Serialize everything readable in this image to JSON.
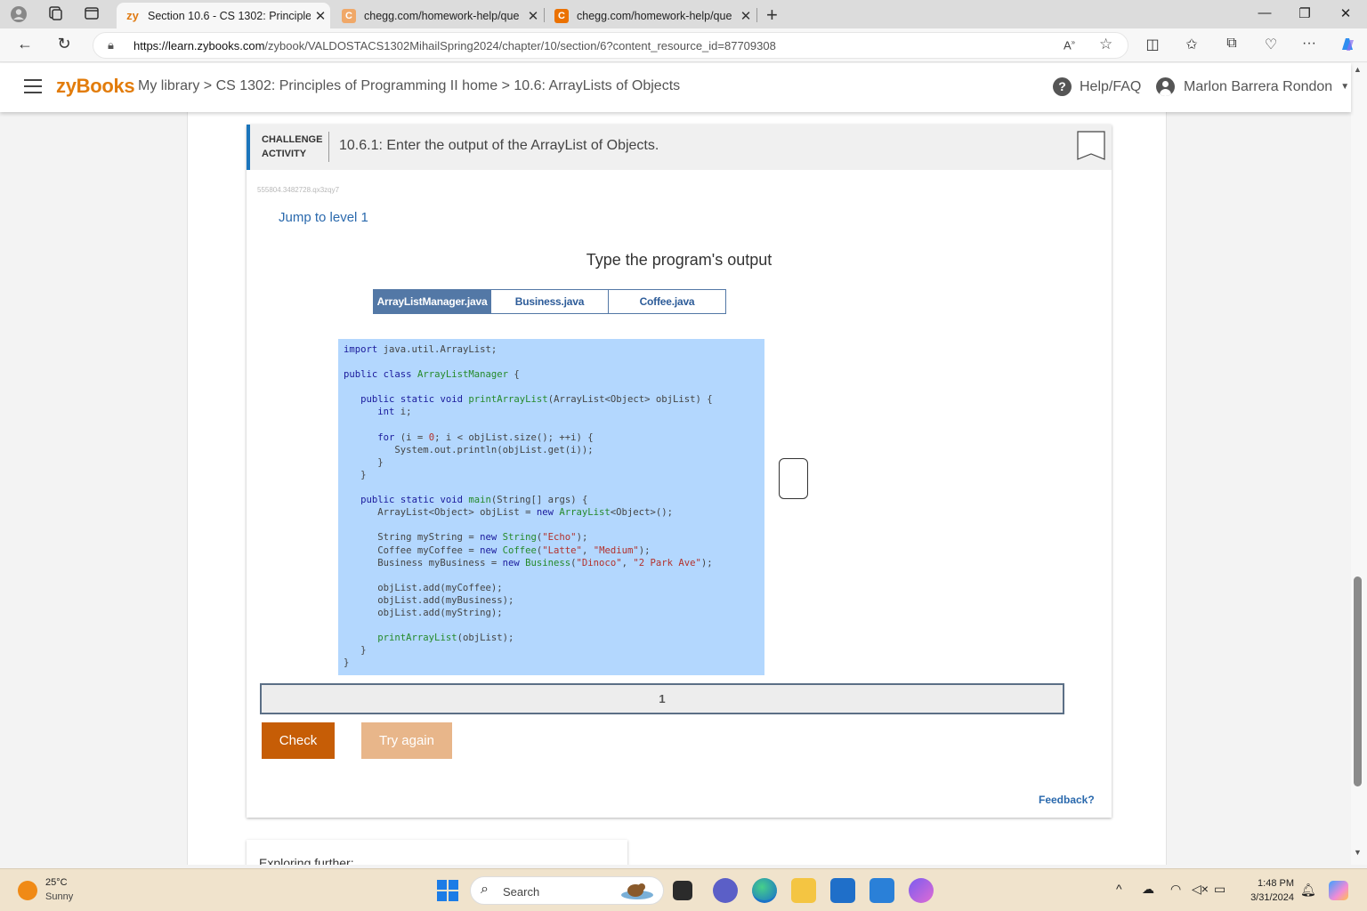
{
  "browser": {
    "tabs": [
      {
        "label": "Section 10.6 - CS 1302: Principles",
        "favicon": "zy",
        "active": true
      },
      {
        "label": "chegg.com/homework-help/que",
        "favicon": "C",
        "active": false
      },
      {
        "label": "chegg.com/homework-help/que",
        "favicon": "C",
        "active": false
      }
    ],
    "url_host": "https://learn.zybooks.com",
    "url_path": "/zybook/VALDOSTACS1302MihailSpring2024/chapter/10/section/6?content_resource_id=87709308"
  },
  "header": {
    "logo": "zyBooks",
    "breadcrumb": "My library > CS 1302: Principles of Programming II home > 10.6: ArrayLists of Objects",
    "help_label": "Help/FAQ",
    "user_name": "Marlon Barrera Rondon"
  },
  "activity": {
    "type_line1": "CHALLENGE",
    "type_line2": "ACTIVITY",
    "title": "10.6.1: Enter the output of the ArrayList of Objects.",
    "id_text": "555804.3482728.qx3zqy7",
    "jump_label": "Jump to level 1",
    "prompt": "Type the program's output",
    "file_tabs": [
      {
        "label": "ArrayListManager.java",
        "active": true
      },
      {
        "label": "Business.java",
        "active": false
      },
      {
        "label": "Coffee.java",
        "active": false
      }
    ],
    "answer_line_number": "1",
    "check_label": "Check",
    "try_again_label": "Try again",
    "feedback_label": "Feedback?"
  },
  "code_lines": [
    "import java.util.ArrayList;",
    "",
    "public class ArrayListManager {",
    "",
    "   public static void printArrayList(ArrayList<Object> objList) {",
    "      int i;",
    "",
    "      for (i = 0; i < objList.size(); ++i) {",
    "         System.out.println(objList.get(i));",
    "      }",
    "   }",
    "",
    "   public static void main(String[] args) {",
    "      ArrayList<Object> objList = new ArrayList<Object>();",
    "",
    "      String myString = new String(\"Echo\");",
    "      Coffee myCoffee = new Coffee(\"Latte\", \"Medium\");",
    "      Business myBusiness = new Business(\"Dinoco\", \"2 Park Ave\");",
    "",
    "      objList.add(myCoffee);",
    "      objList.add(myBusiness);",
    "      objList.add(myString);",
    "",
    "      printArrayList(objList);",
    "   }",
    "}"
  ],
  "next_section_label": "Exploring further:",
  "taskbar": {
    "temperature": "25°C",
    "condition": "Sunny",
    "search_label": "Search",
    "time": "1:48 PM",
    "date": "3/31/2024"
  },
  "colors": {
    "brand_orange": "#e27c0b",
    "link_blue": "#2a69ad",
    "code_bg": "#b3d7fe",
    "check_button": "#c65d06",
    "try_again_button": "#e8b68a"
  }
}
